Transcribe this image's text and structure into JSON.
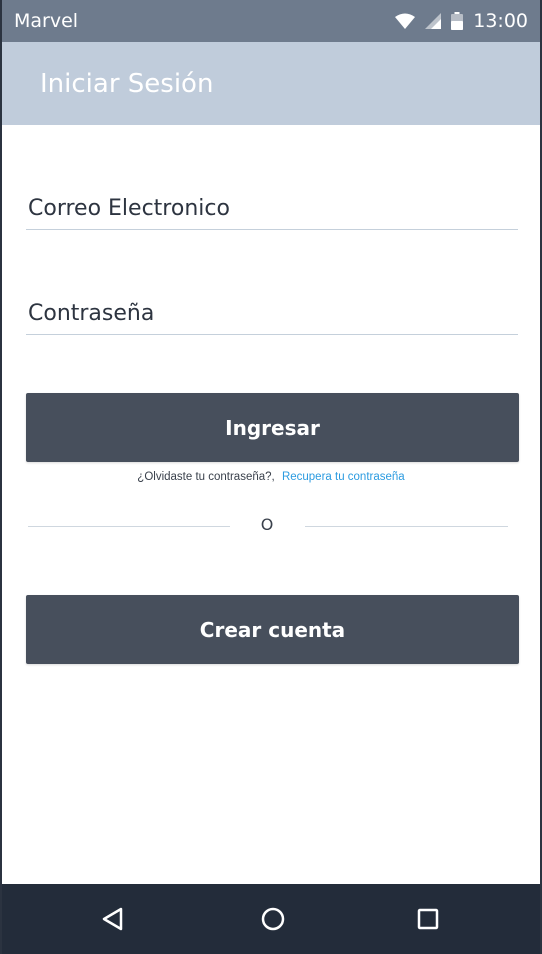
{
  "status_bar": {
    "carrier": "Marvel",
    "time": "13:00",
    "icons": [
      "wifi-icon",
      "signal-icon",
      "battery-icon"
    ]
  },
  "app_bar": {
    "title": "Iniciar Sesión"
  },
  "form": {
    "email": {
      "value": "",
      "placeholder": "Correo Electronico"
    },
    "password": {
      "value": "",
      "placeholder": "Contraseña"
    },
    "login_label": "Ingresar",
    "forgot_text": "¿Olvidaste tu contraseña?,",
    "recover_link": "Recupera tu contraseña",
    "divider_text": "O",
    "create_label": "Crear cuenta"
  },
  "nav_bar": {
    "icons": [
      "back-icon",
      "home-icon",
      "recent-apps-icon"
    ]
  },
  "colors": {
    "status_bar": "#6e7b8d",
    "app_bar": "#c0ccdb",
    "button": "#474f5c",
    "link": "#2b9be0",
    "nav_bar": "#232c3a"
  }
}
